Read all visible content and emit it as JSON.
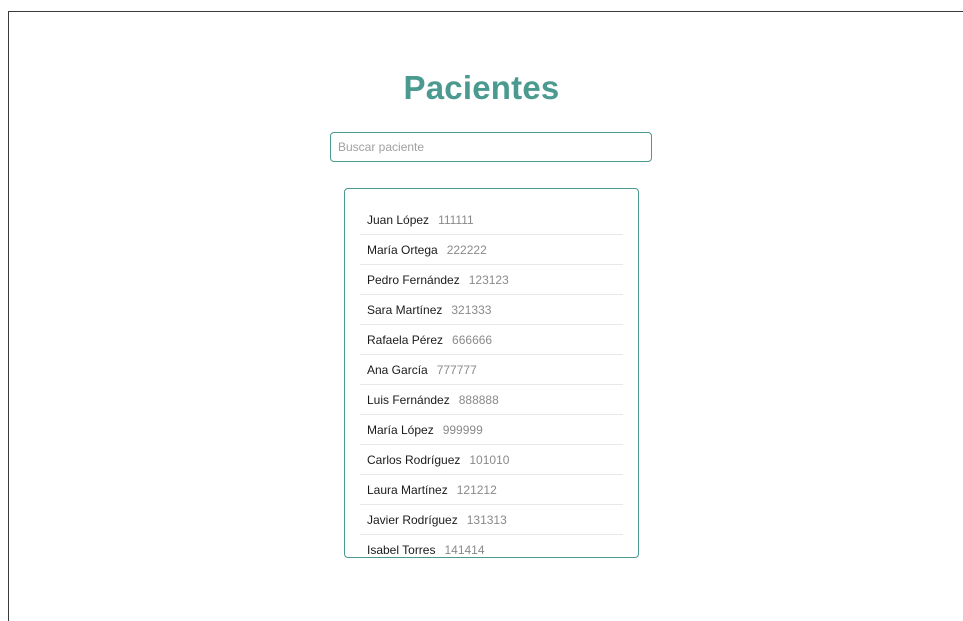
{
  "page": {
    "title": "Pacientes"
  },
  "search": {
    "placeholder": "Buscar paciente",
    "value": ""
  },
  "patients": [
    {
      "name": "Juan López",
      "id": "111111"
    },
    {
      "name": "María Ortega",
      "id": "222222"
    },
    {
      "name": "Pedro Fernández",
      "id": "123123"
    },
    {
      "name": "Sara Martínez",
      "id": "321333"
    },
    {
      "name": "Rafaela Pérez",
      "id": "666666"
    },
    {
      "name": "Ana García",
      "id": "777777"
    },
    {
      "name": "Luis Fernández",
      "id": "888888"
    },
    {
      "name": "María López",
      "id": "999999"
    },
    {
      "name": "Carlos Rodríguez",
      "id": "101010"
    },
    {
      "name": "Laura Martínez",
      "id": "121212"
    },
    {
      "name": "Javier Rodríguez",
      "id": "131313"
    },
    {
      "name": "Isabel Torres",
      "id": "141414"
    }
  ],
  "colors": {
    "accent": "#4a9a8f",
    "text": "#1a1a1a",
    "muted": "#8a8a8a",
    "divider": "#e8e8e8"
  }
}
